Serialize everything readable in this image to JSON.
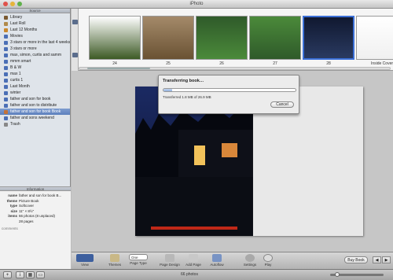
{
  "window": {
    "title": "iPhoto"
  },
  "sidebar": {
    "header": "Source",
    "items": [
      {
        "label": "Library",
        "icon": "library-icon",
        "color": "#7b5a32"
      },
      {
        "label": "Last Roll",
        "icon": "roll-icon",
        "color": "#b08a4a"
      },
      {
        "label": "Last 12 Months",
        "icon": "calendar-icon",
        "color": "#c9882c"
      },
      {
        "label": "Movies",
        "icon": "film-icon",
        "color": "#4b6fb6"
      },
      {
        "label": "3 stars or more in the last 4 weeks",
        "icon": "smart-album-icon",
        "color": "#4b6fb6"
      },
      {
        "label": "3 stars or more",
        "icon": "smart-album-icon",
        "color": "#4b6fb6"
      },
      {
        "label": "max, simon, curtis and samm",
        "icon": "smart-album-icon",
        "color": "#4b6fb6"
      },
      {
        "label": "mmm smart",
        "icon": "smart-album-icon",
        "color": "#4b6fb6"
      },
      {
        "label": "B & W",
        "icon": "album-icon",
        "color": "#4b6fb6"
      },
      {
        "label": "max 1",
        "icon": "album-icon",
        "color": "#4b6fb6"
      },
      {
        "label": "curtis 1",
        "icon": "album-icon",
        "color": "#4b6fb6"
      },
      {
        "label": "Last Month",
        "icon": "album-icon",
        "color": "#4b6fb6"
      },
      {
        "label": "winter",
        "icon": "album-icon",
        "color": "#4b6fb6"
      },
      {
        "label": "father and son for book",
        "icon": "book-icon",
        "color": "#4b6fb6"
      },
      {
        "label": "father and son to distribute",
        "icon": "book-icon",
        "color": "#4b6fb6"
      },
      {
        "label": "father and son for book Book",
        "icon": "book-icon",
        "color": "#c4733a",
        "selected": true
      },
      {
        "label": "father and sons weekend",
        "icon": "album-icon",
        "color": "#4b6fb6"
      },
      {
        "label": "Trash",
        "icon": "trash-icon",
        "color": "#888888"
      }
    ]
  },
  "info": {
    "header": "Information",
    "rows": [
      {
        "k": "name",
        "v": "father and son for book B..."
      },
      {
        "k": "theme",
        "v": "Picture Book"
      },
      {
        "k": "type",
        "v": "Softcover"
      },
      {
        "k": "size",
        "v": "11\" × 8½\""
      },
      {
        "k": "items",
        "v": "66 photos (8 unplaced)"
      },
      {
        "k": "",
        "v": "28 pages"
      }
    ],
    "comments": "comments"
  },
  "pagestrip": {
    "pages": [
      {
        "label": "24",
        "colors": [
          "#ffffff",
          "#3d5a25"
        ]
      },
      {
        "label": "25",
        "colors": [
          "#a48a6a",
          "#6a5233"
        ]
      },
      {
        "label": "26",
        "colors": [
          "#2f5a2a",
          "#4b8a3a"
        ]
      },
      {
        "label": "27",
        "colors": [
          "#4b8a3a",
          "#2f5a2a"
        ]
      },
      {
        "label": "28",
        "colors": [
          "#101830",
          "#2a3a60"
        ]
      },
      {
        "label": "Inside Cover",
        "colors": [
          "#ffffff",
          "#f0f0f0"
        ]
      }
    ]
  },
  "dialog": {
    "title": "Transferring book…",
    "status": "Transferred 1.8 MB of 26.9 MB",
    "progress": 0.067,
    "cancel_label": "Cancel"
  },
  "toolbar": {
    "view_label": "View",
    "themes_label": "Themes",
    "page_type_label": "Page Type",
    "page_type_value": "One",
    "page_design_label": "Page Design",
    "add_page_label": "Add Page",
    "autoflow_label": "Autoflow",
    "settings_label": "Settings",
    "play_label": "Play",
    "buy_book_label": "Buy Book",
    "prev_glyph": "◀",
    "next_glyph": "▶"
  },
  "statusbar": {
    "photo_count": "66 photos",
    "add_glyph": "+",
    "info_glyph": "i",
    "calendar_glyph": "▦",
    "slideshow_glyph": "▭"
  }
}
